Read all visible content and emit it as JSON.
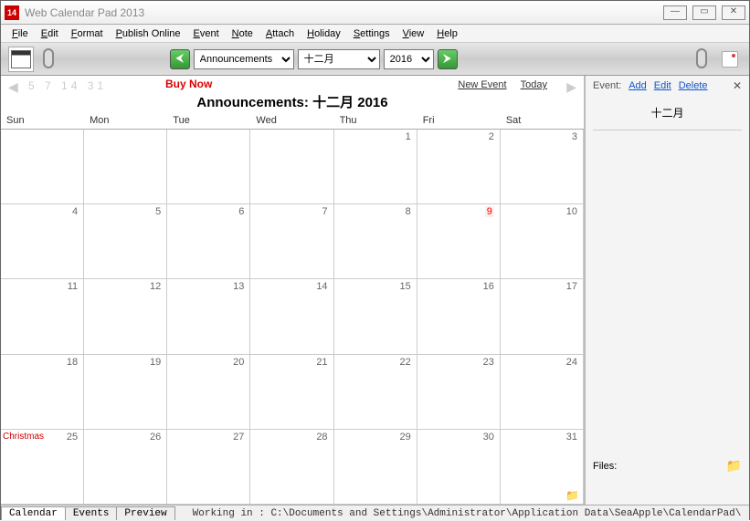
{
  "window": {
    "title": "Web Calendar Pad 2013",
    "icon_text": "14"
  },
  "menu": [
    "File",
    "Edit",
    "Format",
    "Publish Online",
    "Event",
    "Note",
    "Attach",
    "Holiday",
    "Settings",
    "View",
    "Help"
  ],
  "toolbar": {
    "category": "Announcements",
    "month": "十二月",
    "year": "2016"
  },
  "subheader": {
    "past": "5  7  14   31",
    "buy_now": "Buy Now",
    "new_event": "New Event",
    "today": "Today",
    "cal_title": "Announcements: 十二月 2016"
  },
  "day_headers": [
    "Sun",
    "Mon",
    "Tue",
    "Wed",
    "Thu",
    "Fri",
    "Sat"
  ],
  "grid": [
    [
      {
        "n": ""
      },
      {
        "n": ""
      },
      {
        "n": ""
      },
      {
        "n": ""
      },
      {
        "n": "1"
      },
      {
        "n": "2"
      },
      {
        "n": "3"
      }
    ],
    [
      {
        "n": "4"
      },
      {
        "n": "5"
      },
      {
        "n": "6"
      },
      {
        "n": "7"
      },
      {
        "n": "8"
      },
      {
        "n": "9",
        "today": true
      },
      {
        "n": "10"
      }
    ],
    [
      {
        "n": "11"
      },
      {
        "n": "12"
      },
      {
        "n": "13"
      },
      {
        "n": "14"
      },
      {
        "n": "15"
      },
      {
        "n": "16"
      },
      {
        "n": "17"
      }
    ],
    [
      {
        "n": "18"
      },
      {
        "n": "19"
      },
      {
        "n": "20"
      },
      {
        "n": "21"
      },
      {
        "n": "22"
      },
      {
        "n": "23"
      },
      {
        "n": "24"
      }
    ],
    [
      {
        "n": "25",
        "ev": "Christmas"
      },
      {
        "n": "26"
      },
      {
        "n": "27"
      },
      {
        "n": "28"
      },
      {
        "n": "29"
      },
      {
        "n": "30"
      },
      {
        "n": "31",
        "folder": true
      }
    ]
  ],
  "sidebar": {
    "event_label": "Event:",
    "add": "Add",
    "edit": "Edit",
    "delete": "Delete",
    "month": "十二月",
    "files_label": "Files:"
  },
  "tabs": [
    "Calendar",
    "Events",
    "Preview"
  ],
  "status": "Working in : C:\\Documents and Settings\\Administrator\\Application Data\\SeaApple\\CalendarPad\\"
}
